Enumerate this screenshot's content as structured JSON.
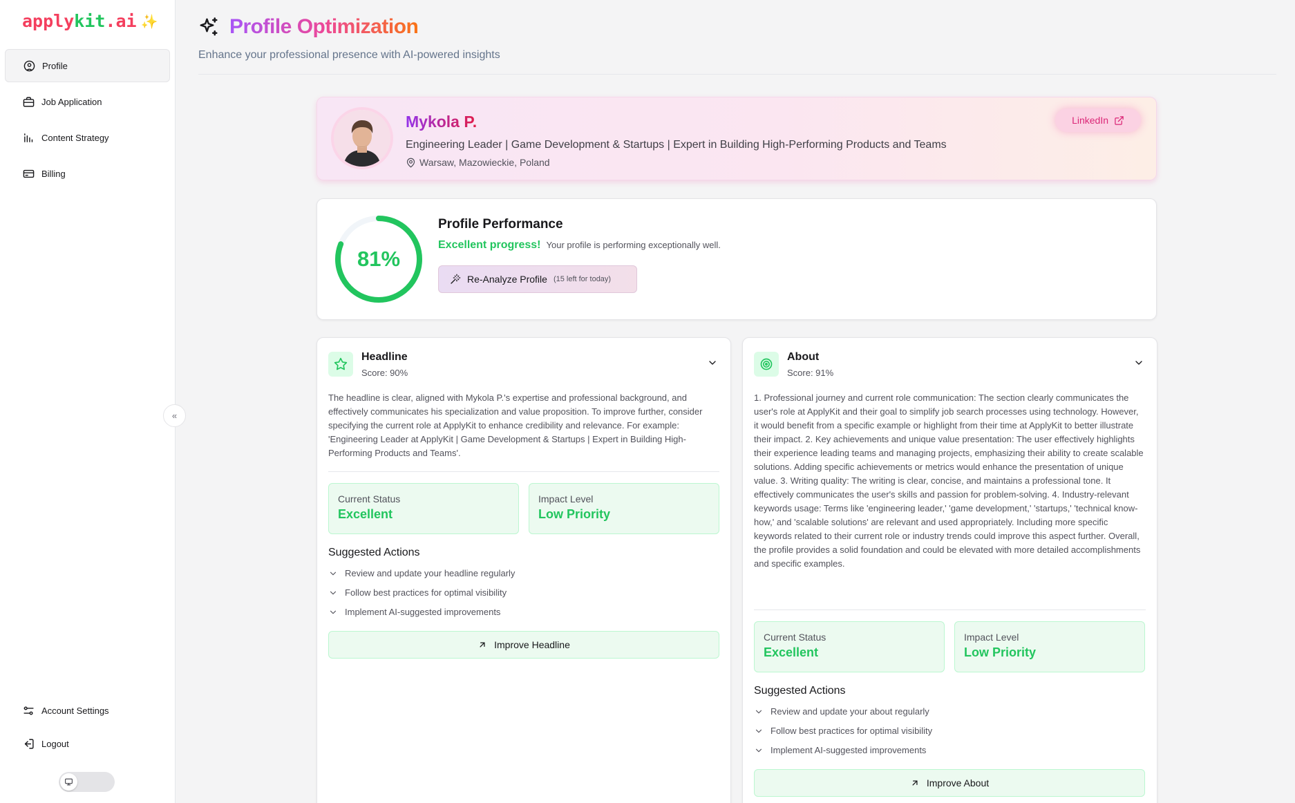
{
  "app": {
    "logo_part1": "apply",
    "logo_part2": "kit",
    "logo_part3": ".ai"
  },
  "sidebar": {
    "items": [
      {
        "label": "Profile",
        "icon": "user-circle-icon",
        "active": true
      },
      {
        "label": "Job Application",
        "icon": "briefcase-icon"
      },
      {
        "label": "Content Strategy",
        "icon": "bar-chart-icon"
      },
      {
        "label": "Billing",
        "icon": "credit-card-icon"
      }
    ],
    "bottom_items": [
      {
        "label": "Account Settings",
        "icon": "sliders-icon"
      },
      {
        "label": "Logout",
        "icon": "logout-icon"
      }
    ]
  },
  "header": {
    "title": "Profile Optimization",
    "subtitle": "Enhance your professional presence with AI-powered insights"
  },
  "profile": {
    "name": "Mykola P.",
    "headline": "Engineering Leader | Game Development & Startups | Expert in Building High-Performing Products and Teams",
    "location": "Warsaw, Mazowieckie, Poland",
    "linkedin_label": "LinkedIn"
  },
  "performance": {
    "title": "Profile Performance",
    "score": 81,
    "score_label": "81%",
    "highlight": "Excellent progress!",
    "description": "Your profile is performing exceptionally well.",
    "reanalyze_label": "Re-Analyze Profile",
    "reanalyze_note": "(15 left for today)"
  },
  "sections": [
    {
      "title": "Headline",
      "score": "Score: 90%",
      "icon": "star-icon",
      "body": "The headline is clear, aligned with Mykola P.'s expertise and professional background, and effectively communicates his specialization and value proposition. To improve further, consider specifying the current role at ApplyKit to enhance credibility and relevance. For example: 'Engineering Leader at ApplyKit | Game Development & Startups | Expert in Building High-Performing Products and Teams'.",
      "status_label": "Current Status",
      "status_value": "Excellent",
      "impact_label": "Impact Level",
      "impact_value": "Low Priority",
      "actions_title": "Suggested Actions",
      "actions": [
        "Review and update your headline regularly",
        "Follow best practices for optimal visibility",
        "Implement AI-suggested improvements"
      ],
      "button_label": "Improve Headline"
    },
    {
      "title": "About",
      "score": "Score: 91%",
      "icon": "target-icon",
      "body": "1. Professional journey and current role communication: The section clearly communicates the user's role at ApplyKit and their goal to simplify job search processes using technology. However, it would benefit from a specific example or highlight from their time at ApplyKit to better illustrate their impact. 2. Key achievements and unique value presentation: The user effectively highlights their experience leading teams and managing projects, emphasizing their ability to create scalable solutions. Adding specific achievements or metrics would enhance the presentation of unique value. 3. Writing quality: The writing is clear, concise, and maintains a professional tone. It effectively communicates the user's skills and passion for problem-solving. 4. Industry-relevant keywords usage: Terms like 'engineering leader,' 'game development,' 'startups,' 'technical know-how,' and 'scalable solutions' are relevant and used appropriately. Including more specific keywords related to their current role or industry trends could improve this aspect further. Overall, the profile provides a solid foundation and could be elevated with more detailed accomplishments and specific examples.",
      "status_label": "Current Status",
      "status_value": "Excellent",
      "impact_label": "Impact Level",
      "impact_value": "Low Priority",
      "actions_title": "Suggested Actions",
      "actions": [
        "Review and update your about regularly",
        "Follow best practices for optimal visibility",
        "Implement AI-suggested improvements"
      ],
      "button_label": "Improve About"
    }
  ],
  "colors": {
    "accent_green": "#22c55e",
    "accent_pink": "#ec4899",
    "accent_purple": "#a855f7",
    "accent_orange": "#f97316"
  }
}
